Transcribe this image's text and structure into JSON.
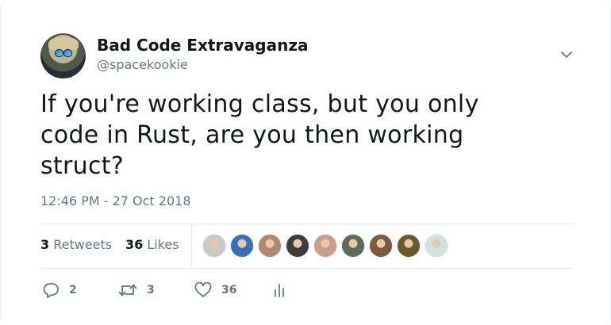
{
  "tweet": {
    "display_name": "Bad Code Extravaganza",
    "handle": "@spacekookie",
    "text_lines": [
      "If you're working class, but you only",
      "code in Rust, are you then working",
      "struct?"
    ],
    "timestamp": "12:46 PM - 27 Oct 2018"
  },
  "stats": {
    "retweets_count": "3",
    "retweets_label": "Retweets",
    "likes_count": "36",
    "likes_label": "Likes"
  },
  "likers": [
    {
      "icon": "liker-avatar",
      "color": "#c9c9c9"
    },
    {
      "icon": "liker-avatar",
      "color": "#3a6fb5"
    },
    {
      "icon": "liker-avatar",
      "color": "#b08770"
    },
    {
      "icon": "liker-avatar",
      "color": "#3b3b3b"
    },
    {
      "icon": "liker-avatar",
      "color": "#c8a08a"
    },
    {
      "icon": "liker-avatar",
      "color": "#5f6a5a"
    },
    {
      "icon": "liker-avatar",
      "color": "#7a5a40"
    },
    {
      "icon": "liker-avatar",
      "color": "#6a5a2a"
    },
    {
      "icon": "liker-avatar",
      "color": "#cfe3e0"
    }
  ],
  "actions": {
    "reply_count": "2",
    "retweet_count": "3",
    "like_count": "36"
  },
  "icons": {
    "menu": "chevron-down-icon",
    "reply": "reply-icon",
    "retweet": "retweet-icon",
    "like": "heart-icon",
    "analytics": "analytics-icon"
  },
  "colors": {
    "text": "#14171a",
    "secondary": "#657786",
    "border": "#e6ecf0"
  }
}
